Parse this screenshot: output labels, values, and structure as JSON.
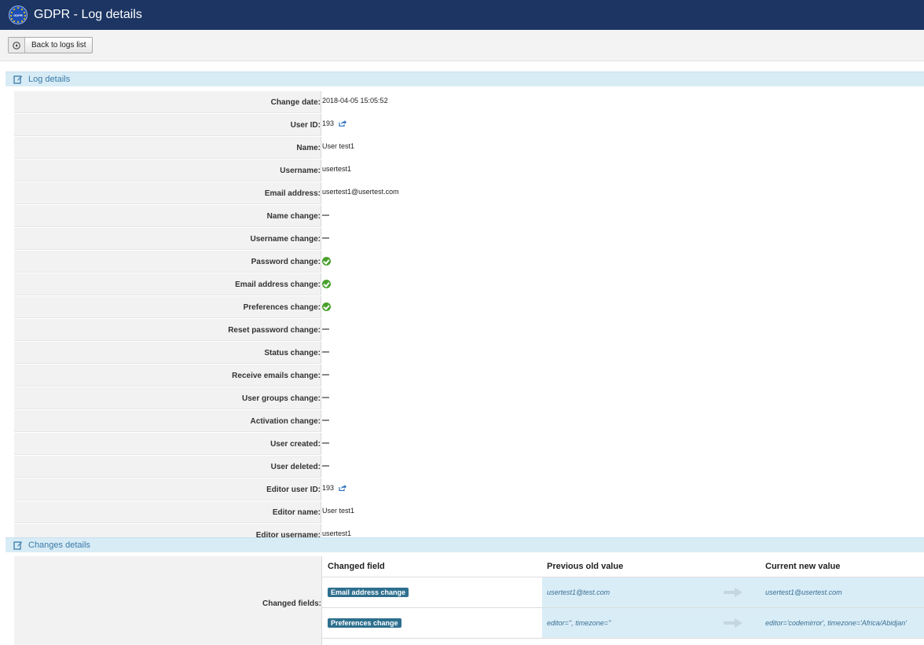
{
  "header": {
    "title": "GDPR - Log details",
    "logo_text": "GDPR"
  },
  "toolbar": {
    "back_label": "Back to logs list"
  },
  "sections": {
    "log_details": "Log details",
    "changes_details": "Changes details"
  },
  "details": [
    {
      "label": "Change date:",
      "value": "2018-04-05 15:05:52",
      "type": "text"
    },
    {
      "label": "User ID:",
      "value": "193",
      "type": "link"
    },
    {
      "label": "Name:",
      "value": "User test1",
      "type": "text"
    },
    {
      "label": "Username:",
      "value": "usertest1",
      "type": "text"
    },
    {
      "label": "Email address:",
      "value": "usertest1@usertest.com",
      "type": "text"
    },
    {
      "label": "Name change:",
      "value": "",
      "type": "dash"
    },
    {
      "label": "Username change:",
      "value": "",
      "type": "dash"
    },
    {
      "label": "Password change:",
      "value": "",
      "type": "check"
    },
    {
      "label": "Email address change:",
      "value": "",
      "type": "check"
    },
    {
      "label": "Preferences change:",
      "value": "",
      "type": "check"
    },
    {
      "label": "Reset password change:",
      "value": "",
      "type": "dash"
    },
    {
      "label": "Status change:",
      "value": "",
      "type": "dash"
    },
    {
      "label": "Receive emails change:",
      "value": "",
      "type": "dash"
    },
    {
      "label": "User groups change:",
      "value": "",
      "type": "dash"
    },
    {
      "label": "Activation change:",
      "value": "",
      "type": "dash"
    },
    {
      "label": "User created:",
      "value": "",
      "type": "dash"
    },
    {
      "label": "User deleted:",
      "value": "",
      "type": "dash"
    },
    {
      "label": "Editor user ID:",
      "value": "193",
      "type": "link"
    },
    {
      "label": "Editor name:",
      "value": "User test1",
      "type": "text"
    },
    {
      "label": "Editor username:",
      "value": "usertest1",
      "type": "text"
    }
  ],
  "changes": {
    "label": "Changed fields:",
    "columns": [
      "Changed field",
      "Previous old value",
      "Current new value"
    ],
    "rows": [
      {
        "field": "Email address change",
        "old": "usertest1@test.com",
        "new": "usertest1@usertest.com"
      },
      {
        "field": "Preferences change",
        "old": "editor='', timezone=''",
        "new": "editor='codemirror', timezone='Africa/Abidjan'"
      }
    ]
  },
  "colors": {
    "header_bg": "#1c3563",
    "section_bg": "#d8ecf6",
    "badge_bg": "#2e6f8e",
    "check_green": "#4aa02c"
  }
}
